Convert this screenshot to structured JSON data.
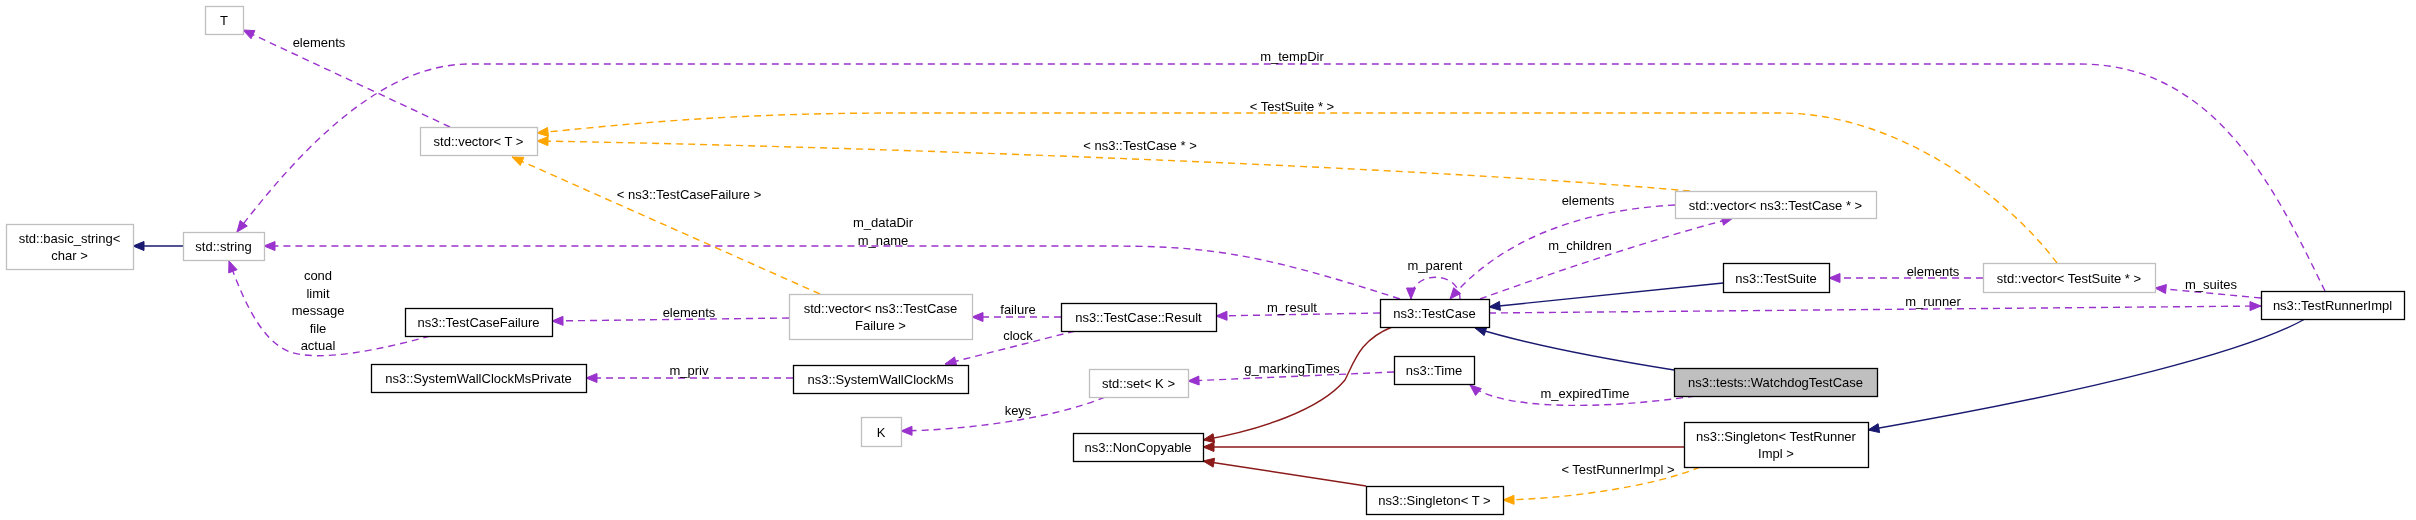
{
  "nodes": [
    {
      "kind": "external",
      "lines": [
        "T"
      ]
    },
    {
      "kind": "external",
      "lines": [
        "std::vector< T >"
      ]
    },
    {
      "kind": "external",
      "lines": [
        "std::basic_string<",
        "char >"
      ]
    },
    {
      "kind": "external",
      "lines": [
        "std::string"
      ]
    },
    {
      "kind": "class",
      "lines": [
        "ns3::TestCaseFailure"
      ]
    },
    {
      "kind": "class",
      "lines": [
        "ns3::SystemWallClockMsPrivate"
      ]
    },
    {
      "kind": "external",
      "lines": [
        "std::vector< ns3::TestCase",
        "Failure >"
      ]
    },
    {
      "kind": "class",
      "lines": [
        "ns3::SystemWallClockMs"
      ]
    },
    {
      "kind": "external",
      "lines": [
        "K"
      ]
    },
    {
      "kind": "class",
      "lines": [
        "ns3::TestCase::Result"
      ]
    },
    {
      "kind": "external",
      "lines": [
        "std::set< K >"
      ]
    },
    {
      "kind": "class",
      "lines": [
        "ns3::NonCopyable"
      ]
    },
    {
      "kind": "class",
      "lines": [
        "ns3::TestCase"
      ]
    },
    {
      "kind": "class",
      "lines": [
        "ns3::Time"
      ]
    },
    {
      "kind": "class",
      "lines": [
        "ns3::Singleton< T >"
      ]
    },
    {
      "kind": "external",
      "lines": [
        "std::vector< ns3::TestCase * >"
      ]
    },
    {
      "kind": "class",
      "lines": [
        "ns3::TestSuite"
      ]
    },
    {
      "kind": "focus",
      "lines": [
        "ns3::tests::WatchdogTestCase"
      ]
    },
    {
      "kind": "class",
      "lines": [
        "ns3::Singleton< TestRunner",
        "Impl >"
      ]
    },
    {
      "kind": "external",
      "lines": [
        "std::vector< TestSuite * >"
      ]
    },
    {
      "kind": "class",
      "lines": [
        "ns3::TestRunnerImpl"
      ]
    }
  ],
  "edges": [
    {
      "kind": "usage",
      "label": [
        "elements"
      ]
    },
    {
      "kind": "usage",
      "label": [
        "m_tempDir"
      ]
    },
    {
      "kind": "template",
      "label": [
        "< TestSuite * >"
      ]
    },
    {
      "kind": "template",
      "label": [
        "< ns3::TestCase * >"
      ]
    },
    {
      "kind": "template",
      "label": [
        "< ns3::TestCaseFailure >"
      ]
    },
    {
      "kind": "usage",
      "label": [
        "m_dataDir",
        "m_name"
      ]
    },
    {
      "kind": "usage",
      "label": [
        "cond",
        "limit",
        "message",
        "file",
        "actual"
      ]
    },
    {
      "kind": "usage",
      "label": [
        "elements"
      ]
    },
    {
      "kind": "usage",
      "label": [
        "failure"
      ]
    },
    {
      "kind": "usage",
      "label": [
        "clock"
      ]
    },
    {
      "kind": "usage",
      "label": [
        "m_priv"
      ]
    },
    {
      "kind": "usage",
      "label": [
        "m_result"
      ]
    },
    {
      "kind": "usage",
      "label": [
        "m_parent"
      ]
    },
    {
      "kind": "usage",
      "label": [
        "elements"
      ]
    },
    {
      "kind": "usage",
      "label": [
        "m_children"
      ]
    },
    {
      "kind": "usage",
      "label": [
        "m_runner"
      ]
    },
    {
      "kind": "inheritance"
    },
    {
      "kind": "inheritance"
    },
    {
      "kind": "usage",
      "label": [
        "m_expiredTime"
      ]
    },
    {
      "kind": "usage",
      "label": [
        "elements"
      ]
    },
    {
      "kind": "usage",
      "label": [
        "m_suites"
      ]
    },
    {
      "kind": "usage",
      "label": [
        "g_markingTimes"
      ]
    },
    {
      "kind": "usage",
      "label": [
        "keys"
      ]
    },
    {
      "kind": "private_inheritance"
    },
    {
      "kind": "private_inheritance"
    },
    {
      "kind": "private_inheritance"
    },
    {
      "kind": "template",
      "label": [
        "< TestRunnerImpl >"
      ]
    },
    {
      "kind": "inheritance"
    },
    {
      "kind": "inheritance"
    }
  ]
}
